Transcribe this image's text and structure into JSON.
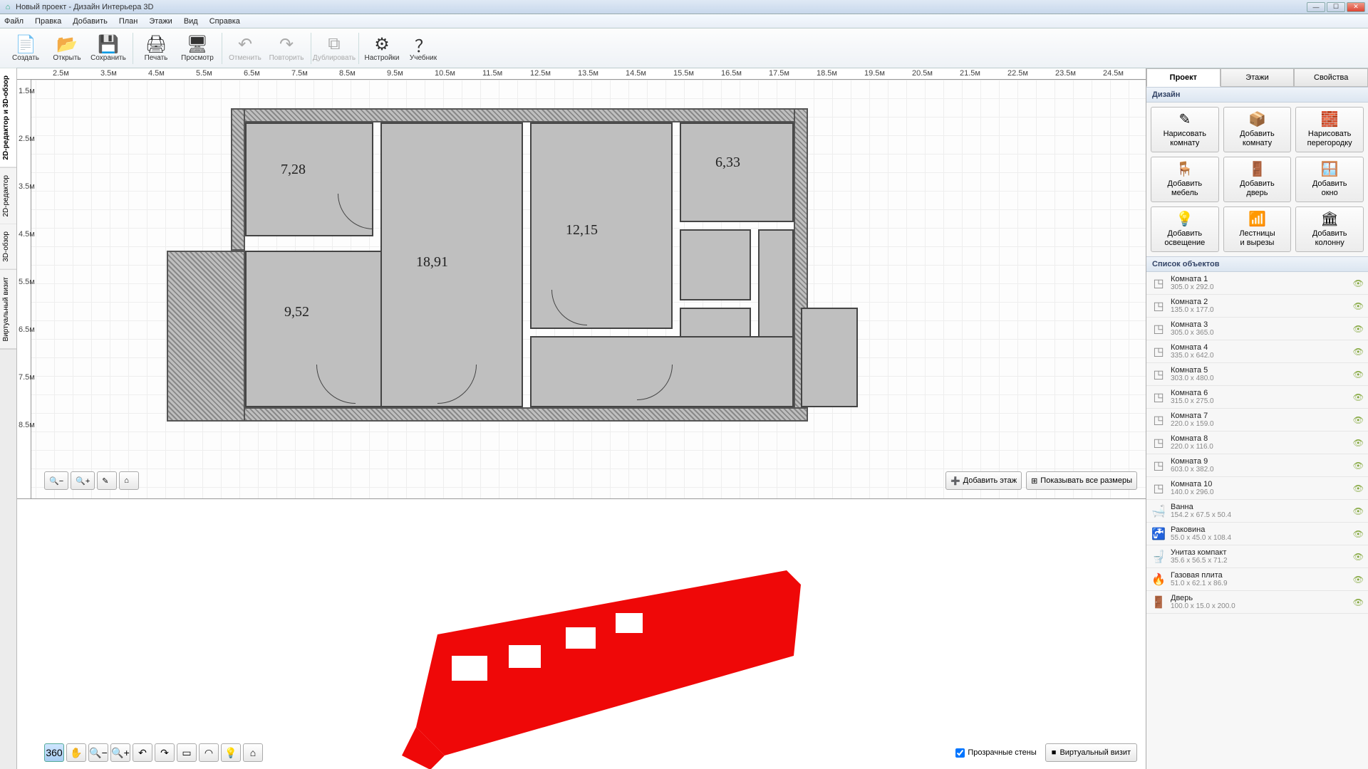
{
  "window": {
    "title": "Новый проект - Дизайн Интерьера 3D"
  },
  "menu": [
    "Файл",
    "Правка",
    "Добавить",
    "План",
    "Этажи",
    "Вид",
    "Справка"
  ],
  "toolbar": [
    {
      "id": "create",
      "label": "Создать",
      "icon": "📄"
    },
    {
      "id": "open",
      "label": "Открыть",
      "icon": "📂"
    },
    {
      "id": "save",
      "label": "Сохранить",
      "icon": "💾"
    },
    {
      "sep": true
    },
    {
      "id": "print",
      "label": "Печать",
      "icon": "🖨"
    },
    {
      "id": "preview",
      "label": "Просмотр",
      "icon": "🖥"
    },
    {
      "sep": true
    },
    {
      "id": "undo",
      "label": "Отменить",
      "icon": "↶",
      "disabled": true
    },
    {
      "id": "redo",
      "label": "Повторить",
      "icon": "↷",
      "disabled": true
    },
    {
      "sep": true
    },
    {
      "id": "duplicate",
      "label": "Дублировать",
      "icon": "⧉",
      "disabled": true
    },
    {
      "sep": true
    },
    {
      "id": "settings",
      "label": "Настройки",
      "icon": "⚙"
    },
    {
      "id": "tutorial",
      "label": "Учебник",
      "icon": "？"
    }
  ],
  "left_tabs": [
    "2D-редактор и 3D-обзор",
    "2D-редактор",
    "3D-обзор",
    "Виртуальный визит"
  ],
  "ruler_h": [
    "2.5м",
    "3.5м",
    "4.5м",
    "5.5м",
    "6.5м",
    "7.5м",
    "8.5м",
    "9.5м",
    "10.5м",
    "11.5м",
    "12.5м",
    "13.5м",
    "14.5м",
    "15.5м",
    "16.5м",
    "17.5м",
    "18.5м",
    "19.5м",
    "20.5м",
    "21.5м",
    "22.5м",
    "23.5м",
    "24.5м"
  ],
  "ruler_v": [
    "1.5м",
    "2.5м",
    "3.5м",
    "4.5м",
    "5.5м",
    "6.5м",
    "7.5м",
    "8.5м"
  ],
  "room_labels": {
    "r1": "7,28",
    "r2": "9,52",
    "r3": "18,91",
    "r4": "12,15",
    "r5": "6,33"
  },
  "plan_buttons": {
    "add_floor": "Добавить этаж",
    "show_dims": "Показывать все размеры"
  },
  "view3d": {
    "transparent_walls": "Прозрачные стены",
    "virtual_visit": "Виртуальный визит"
  },
  "right": {
    "tabs": [
      "Проект",
      "Этажи",
      "Свойства"
    ],
    "design_header": "Дизайн",
    "tools": [
      {
        "id": "draw-room",
        "label": "Нарисовать комнату",
        "icon": "✎"
      },
      {
        "id": "add-room",
        "label": "Добавить комнату",
        "icon": "📦"
      },
      {
        "id": "draw-partition",
        "label": "Нарисовать перегородку",
        "icon": "🧱"
      },
      {
        "id": "add-furniture",
        "label": "Добавить мебель",
        "icon": "🪑"
      },
      {
        "id": "add-door",
        "label": "Добавить дверь",
        "icon": "🚪"
      },
      {
        "id": "add-window",
        "label": "Добавить окно",
        "icon": "🪟"
      },
      {
        "id": "add-light",
        "label": "Добавить освещение",
        "icon": "💡"
      },
      {
        "id": "stairs",
        "label": "Лестницы и вырезы",
        "icon": "📶"
      },
      {
        "id": "add-column",
        "label": "Добавить колонну",
        "icon": "🏛"
      }
    ],
    "objects_header": "Список объектов",
    "objects": [
      {
        "name": "Комната 1",
        "dims": "305.0 x 292.0",
        "icon": "◳"
      },
      {
        "name": "Комната 2",
        "dims": "135.0 x 177.0",
        "icon": "◳"
      },
      {
        "name": "Комната 3",
        "dims": "305.0 x 365.0",
        "icon": "◳"
      },
      {
        "name": "Комната 4",
        "dims": "335.0 x 642.0",
        "icon": "◳"
      },
      {
        "name": "Комната 5",
        "dims": "303.0 x 480.0",
        "icon": "◳"
      },
      {
        "name": "Комната 6",
        "dims": "315.0 x 275.0",
        "icon": "◳"
      },
      {
        "name": "Комната 7",
        "dims": "220.0 x 159.0",
        "icon": "◳"
      },
      {
        "name": "Комната 8",
        "dims": "220.0 x 116.0",
        "icon": "◳"
      },
      {
        "name": "Комната 9",
        "dims": "603.0 x 382.0",
        "icon": "◳"
      },
      {
        "name": "Комната 10",
        "dims": "140.0 x 296.0",
        "icon": "◳"
      },
      {
        "name": "Ванна",
        "dims": "154.2 x 67.5 x 50.4",
        "icon": "🛁"
      },
      {
        "name": "Раковина",
        "dims": "55.0 x 45.0 x 108.4",
        "icon": "🚰"
      },
      {
        "name": "Унитаз компакт",
        "dims": "35.6 x 56.5 x 71.2",
        "icon": "🚽"
      },
      {
        "name": "Газовая плита",
        "dims": "51.0 x 62.1 x 86.9",
        "icon": "🔥"
      },
      {
        "name": "Дверь",
        "dims": "100.0 x 15.0 x 200.0",
        "icon": "🚪"
      }
    ]
  }
}
